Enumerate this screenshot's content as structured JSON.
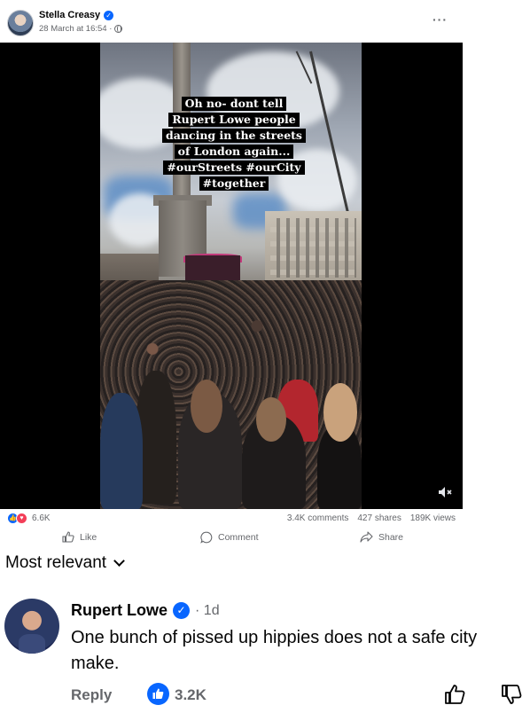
{
  "post": {
    "author": "Stella Creasy",
    "timestamp": "28 March at 16:54 ·",
    "more_icon": "more-icon",
    "privacy_icon": "globe-icon"
  },
  "video": {
    "caption_lines": [
      "Oh no- dont tell",
      "Rupert Lowe people",
      "dancing in the streets",
      "of London again...",
      "#ourStreets #ourCity",
      "#together"
    ],
    "mute_icon": "volume-muted-icon"
  },
  "stats": {
    "reaction_count": "6.6K",
    "comments": "3.4K comments",
    "shares": "427 shares",
    "views": "189K views"
  },
  "actions": {
    "like": "Like",
    "comment": "Comment",
    "share": "Share"
  },
  "comments_section": {
    "sort_label": "Most relevant",
    "comment": {
      "author": "Rupert Lowe",
      "age": "· 1d",
      "text": "One bunch of pissed up hippies does not a safe city make.",
      "reply_label": "Reply",
      "like_count": "3.2K"
    }
  },
  "colors": {
    "accent": "#0866ff",
    "love": "#f33e58",
    "secondary_text": "#65676b"
  }
}
